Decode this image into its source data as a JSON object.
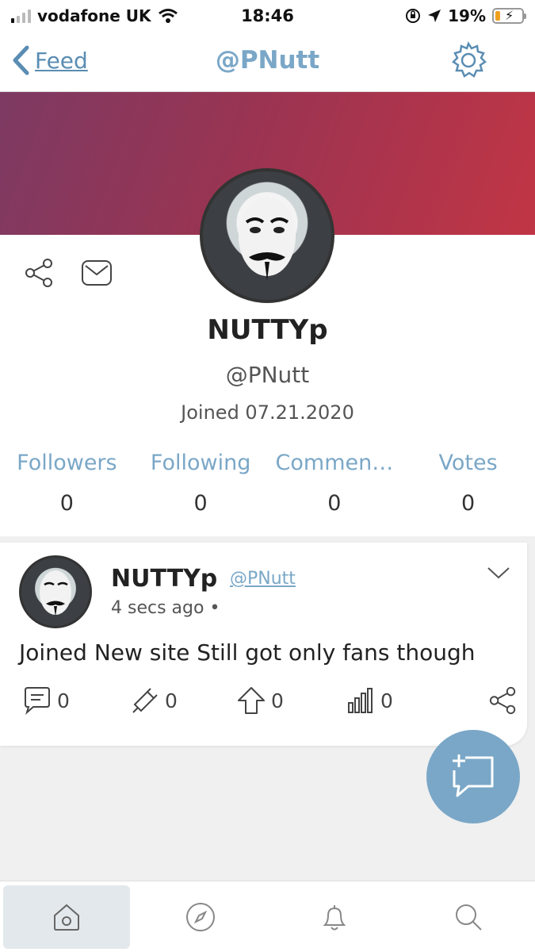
{
  "status_bar": {
    "carrier": "vodafone UK",
    "time": "18:46",
    "battery_percent": "19%",
    "battery_level": 0.19,
    "icons": [
      "signal-icon",
      "wifi-icon",
      "rotation-lock-icon",
      "location-arrow-icon",
      "battery-icon"
    ]
  },
  "nav": {
    "back_label": "Feed",
    "title": "@PNutt",
    "icons": [
      "chevron-left-icon",
      "gear-icon"
    ]
  },
  "colors": {
    "accent": "#7aa7c7",
    "banner_start": "#7d3a63",
    "banner_end": "#c13545"
  },
  "profile": {
    "display_name": "NUTTYp",
    "handle": "@PNutt",
    "joined": "Joined 07.21.2020",
    "icons": [
      "share-icon",
      "mail-icon"
    ],
    "stats": [
      {
        "label": "Followers",
        "value": "0"
      },
      {
        "label": "Following",
        "value": "0"
      },
      {
        "label": "Commen…",
        "value": "0"
      },
      {
        "label": "Votes",
        "value": "0"
      }
    ]
  },
  "post": {
    "author_name": "NUTTYp",
    "author_handle": "@PNutt",
    "time": "4 secs ago •",
    "text": "Joined New site Still got only fans though",
    "counts": {
      "comments": "0",
      "boosts": "0",
      "upvotes": "0",
      "views": "0"
    },
    "icons": [
      "chevron-down-icon",
      "comment-icon",
      "boost-icon",
      "upvote-icon",
      "stats-icon",
      "share-icon"
    ]
  },
  "fab": {
    "icon": "new-post-icon"
  },
  "tab_bar": {
    "tabs": [
      "home-icon",
      "compass-icon",
      "bell-icon",
      "search-icon"
    ],
    "active": 0
  }
}
